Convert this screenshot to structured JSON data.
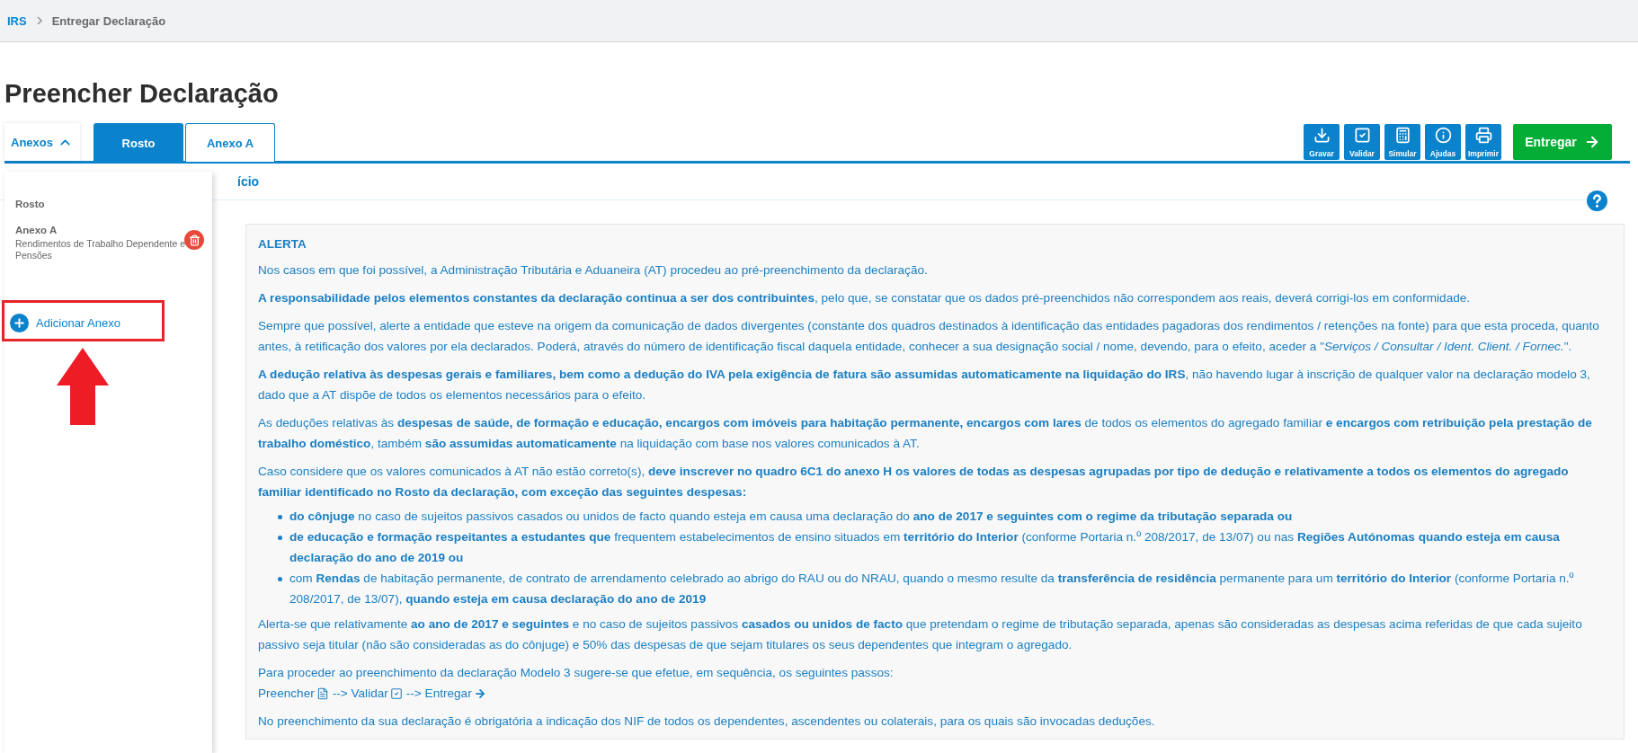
{
  "breadcrumb": [
    {
      "label": "IRS",
      "kind": "link"
    },
    {
      "label": "Entregar Declaração",
      "kind": "current"
    }
  ],
  "page_title": "Preencher Declaração",
  "annexes_toggle": {
    "label": "Anexos",
    "expanded": true
  },
  "tabs": [
    {
      "label": "Rosto",
      "selected": true
    },
    {
      "label": "Anexo A",
      "selected": false
    }
  ],
  "toolbar": [
    "Gravar",
    "Validar",
    "Simular",
    "Ajudas",
    "Imprimir"
  ],
  "submit_button": "Entregar",
  "annexes_menu": {
    "items": [
      {
        "title": "Rosto",
        "removable": false
      },
      {
        "title": "Anexo A",
        "subtitle": "Rendimentos de Trabalho Dependente e Pensões",
        "removable": true
      }
    ],
    "add_button": "Adicionar Anexo",
    "highlighted": true
  },
  "section_title": "ício",
  "alert": {
    "title": "ALERTA",
    "blocks": [
      {
        "kind": "text",
        "text": "Nos casos em que foi possível, a Administração Tributária e Aduaneira (AT) procedeu ao pré-preenchimento da declaração."
      },
      {
        "kind": "text",
        "text": "**A responsabilidade pelos elementos constantes da declaração continua a ser dos contribuintes**, pelo que, se constatar que os dados pré-preenchidos não correspondem aos reais, deverá corrigi-los em conformidade."
      },
      {
        "kind": "text",
        "text": "Sempre que possível, alerte a entidade que esteve na origem da comunicação de dados divergentes (constante dos quadros destinados à identificação das entidades pagadoras dos rendimentos / retenções na fonte) para que esta proceda, quanto antes, à retificação dos valores por ela declarados. Poderá, através do número de identificação fiscal daquela entidade, conhecer a sua designação social / nome, devendo, para o efeito, aceder a \"*Serviços / Consultar / Ident. Client. / Fornec.*\"."
      },
      {
        "kind": "text",
        "text": "**A dedução relativa às despesas gerais e familiares, bem como a dedução do IVA pela exigência de fatura são assumidas automaticamente na liquidação do IRS**, não havendo lugar à inscrição de qualquer valor na declaração modelo 3, dado que a AT dispõe de todos os elementos necessários para o efeito."
      },
      {
        "kind": "text",
        "text": "As deduções relativas às **despesas de saúde, de formação e educação, encargos com imóveis para habitação permanente, encargos com lares** de todos os elementos do agregado familiar **e encargos com retribuição pela prestação de trabalho doméstico**, também **são assumidas automaticamente** na liquidação com base nos valores comunicados à AT."
      },
      {
        "kind": "text",
        "text": "Caso considere que os valores comunicados à AT não estão correto(s), **deve inscrever no quadro 6C1 do anexo H os valores de todas as despesas agrupadas por tipo de dedução e relativamente a todos os elementos do agregado familiar identificado no Rosto da declaração, com exceção das seguintes despesas:**"
      },
      {
        "kind": "list",
        "items": [
          "**do cônjuge** no caso de sujeitos passivos casados ou unidos de facto quando esteja em causa uma declaração do **ano de 2017 e seguintes com o regime da tributação separada ou**",
          "**de educação e formação respeitantes a estudantes que** frequentem estabelecimentos de ensino situados em **território do Interior** (conforme Portaria n.º 208/2017, de 13/07) ou nas **Regiões Autónomas quando esteja em causa declaração do ano de 2019 ou**",
          "com **Rendas** de habitação permanente, de contrato de arrendamento celebrado ao abrigo do RAU ou do NRAU, quando o mesmo resulte da **transferência de residência** permanente para um **território do Interior** (conforme Portaria n.º 208/2017, de 13/07), **quando esteja em causa declaração do ano de 2019**"
        ]
      },
      {
        "kind": "text",
        "text": "Alerta-se que relativamente **ao ano de 2017 e seguintes** e no caso de sujeitos passivos **casados ou unidos de facto** que pretendam o regime de tributação separada, apenas são consideradas as despesas acima referidas de que cada sujeito passivo seja titular (não são consideradas as do cônjuge) e 50% das despesas de que sejam titulares os seus dependentes que integram o agregado."
      },
      {
        "kind": "steps",
        "text": "Para proceder ao preenchimento da declaração Modelo 3 sugere-se que efetue, em sequência, os seguintes passos:",
        "steps": [
          "Preencher",
          "--> Validar",
          "--> Entregar"
        ]
      },
      {
        "kind": "text",
        "text": "No preenchimento da sua declaração é obrigatória a indicação dos NIF de todos os dependentes, ascendentes ou colaterais, para os quais são invocadas deduções."
      }
    ]
  }
}
